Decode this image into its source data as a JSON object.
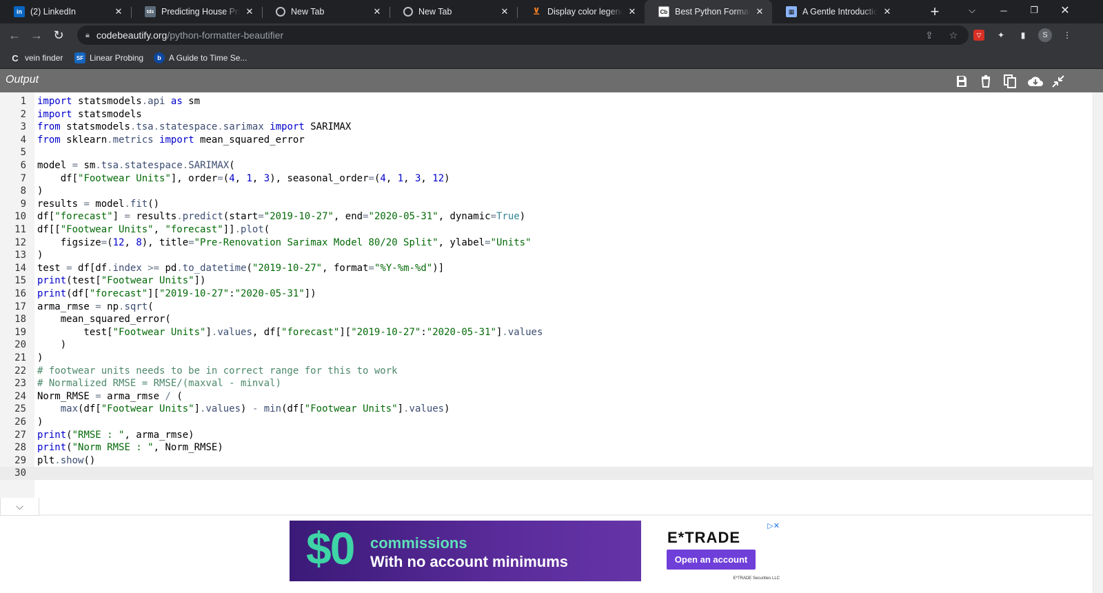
{
  "browser": {
    "tabs": [
      {
        "title": "(2) LinkedIn",
        "favicon": "linkedin-icon",
        "active": false
      },
      {
        "title": "Predicting House Prices",
        "favicon": "tds-icon",
        "active": false
      },
      {
        "title": "New Tab",
        "favicon": "globe-icon",
        "active": false
      },
      {
        "title": "New Tab",
        "favicon": "globe-icon",
        "active": false
      },
      {
        "title": "Display color legend on",
        "favicon": "stackoverflow-icon",
        "active": false
      },
      {
        "title": "Best Python Formatter a",
        "favicon": "codebeautify-icon",
        "active": true
      },
      {
        "title": "A Gentle Introduction t",
        "favicon": "article-icon",
        "active": false
      }
    ],
    "url_domain": "codebeautify.org",
    "url_path": "/python-formatter-beautifier",
    "profile_initial": "S",
    "bookmarks": [
      {
        "label": "vein finder",
        "icon": "c-icon"
      },
      {
        "label": "Linear Probing",
        "icon": "sf-icon"
      },
      {
        "label": "A Guide to Time Se...",
        "icon": "b-icon"
      }
    ]
  },
  "output": {
    "title": "Output"
  },
  "editor": {
    "lines": [
      {
        "n": "1",
        "html": "<span class=\"kw\">import</span> statsmodels<span class=\"op\">.</span><span class=\"fn\">api</span> <span class=\"kw\">as</span> sm"
      },
      {
        "n": "2",
        "html": "<span class=\"kw\">import</span> statsmodels"
      },
      {
        "n": "3",
        "html": "<span class=\"kw\">from</span> statsmodels<span class=\"op\">.</span><span class=\"fn\">tsa</span><span class=\"op\">.</span><span class=\"fn\">statespace</span><span class=\"op\">.</span><span class=\"fn\">sarimax</span> <span class=\"kw\">import</span> SARIMAX"
      },
      {
        "n": "4",
        "html": "<span class=\"kw\">from</span> sklearn<span class=\"op\">.</span><span class=\"fn\">metrics</span> <span class=\"kw\">import</span> mean_squared_error"
      },
      {
        "n": "5",
        "html": ""
      },
      {
        "n": "6",
        "html": "model <span class=\"op\">=</span> sm<span class=\"op\">.</span><span class=\"fn\">tsa</span><span class=\"op\">.</span><span class=\"fn\">statespace</span><span class=\"op\">.</span><span class=\"fn\">SARIMAX</span>("
      },
      {
        "n": "7",
        "html": "    df[<span class=\"str\">\"Footwear Units\"</span>], order<span class=\"op\">=</span>(<span class=\"num\">4</span>, <span class=\"num\">1</span>, <span class=\"num\">3</span>), seasonal_order<span class=\"op\">=</span>(<span class=\"num\">4</span>, <span class=\"num\">1</span>, <span class=\"num\">3</span>, <span class=\"num\">12</span>)"
      },
      {
        "n": "8",
        "html": ")"
      },
      {
        "n": "9",
        "html": "results <span class=\"op\">=</span> model<span class=\"op\">.</span><span class=\"fn\">fit</span>()"
      },
      {
        "n": "10",
        "html": "df[<span class=\"str\">\"forecast\"</span>] <span class=\"op\">=</span> results<span class=\"op\">.</span><span class=\"fn\">predict</span>(start<span class=\"op\">=</span><span class=\"str\">\"2019-10-27\"</span>, end<span class=\"op\">=</span><span class=\"str\">\"2020-05-31\"</span>, dynamic<span class=\"op\">=</span><span class=\"var\">True</span>)"
      },
      {
        "n": "11",
        "html": "df[[<span class=\"str\">\"Footwear Units\"</span>, <span class=\"str\">\"forecast\"</span>]]<span class=\"op\">.</span><span class=\"fn\">plot</span>("
      },
      {
        "n": "12",
        "html": "    figsize<span class=\"op\">=</span>(<span class=\"num\">12</span>, <span class=\"num\">8</span>), title<span class=\"op\">=</span><span class=\"str\">\"Pre-Renovation Sarimax Model 80/20 Split\"</span>, ylabel<span class=\"op\">=</span><span class=\"str\">\"Units\"</span>"
      },
      {
        "n": "13",
        "html": ")"
      },
      {
        "n": "14",
        "html": "test <span class=\"op\">=</span> df[df<span class=\"op\">.</span><span class=\"fn\">index</span> <span class=\"op\">&gt;=</span> pd<span class=\"op\">.</span><span class=\"fn\">to_datetime</span>(<span class=\"str\">\"2019-10-27\"</span>, format<span class=\"op\">=</span><span class=\"str\">\"%Y-%m-%d\"</span>)]"
      },
      {
        "n": "15",
        "html": "<span class=\"kw\">print</span>(test[<span class=\"str\">\"Footwear Units\"</span>])"
      },
      {
        "n": "16",
        "html": "<span class=\"kw\">print</span>(df[<span class=\"str\">\"forecast\"</span>][<span class=\"str\">\"2019-10-27\"</span>:<span class=\"str\">\"2020-05-31\"</span>])"
      },
      {
        "n": "17",
        "html": "arma_rmse <span class=\"op\">=</span> np<span class=\"op\">.</span><span class=\"fn\">sqrt</span>("
      },
      {
        "n": "18",
        "html": "    mean_squared_error("
      },
      {
        "n": "19",
        "html": "        test[<span class=\"str\">\"Footwear Units\"</span>]<span class=\"op\">.</span><span class=\"fn\">values</span>, df[<span class=\"str\">\"forecast\"</span>][<span class=\"str\">\"2019-10-27\"</span>:<span class=\"str\">\"2020-05-31\"</span>]<span class=\"op\">.</span><span class=\"fn\">values</span>"
      },
      {
        "n": "20",
        "html": "    )"
      },
      {
        "n": "21",
        "html": ")"
      },
      {
        "n": "22",
        "html": "<span class=\"cm\"># footwear units needs to be in correct range for this to work</span>"
      },
      {
        "n": "23",
        "html": "<span class=\"cm\"># Normalized RMSE = RMSE/(maxval - minval)</span>"
      },
      {
        "n": "24",
        "html": "Norm_RMSE <span class=\"op\">=</span> arma_rmse <span class=\"op\">/</span> ("
      },
      {
        "n": "25",
        "html": "    <span class=\"fn\">max</span>(df[<span class=\"str\">\"Footwear Units\"</span>]<span class=\"op\">.</span><span class=\"fn\">values</span>) <span class=\"op\">-</span> <span class=\"fn\">min</span>(df[<span class=\"str\">\"Footwear Units\"</span>]<span class=\"op\">.</span><span class=\"fn\">values</span>)"
      },
      {
        "n": "26",
        "html": ")"
      },
      {
        "n": "27",
        "html": "<span class=\"kw\">print</span>(<span class=\"str\">\"RMSE : \"</span>, arma_rmse)"
      },
      {
        "n": "28",
        "html": "<span class=\"kw\">print</span>(<span class=\"str\">\"Norm RMSE : \"</span>, Norm_RMSE)"
      },
      {
        "n": "29",
        "html": "plt<span class=\"op\">.</span><span class=\"fn\">show</span>()"
      },
      {
        "n": "30",
        "html": ""
      }
    ],
    "current_line": "30"
  },
  "ad": {
    "big": "$0",
    "line1": "commissions",
    "line2": "With no account minimums",
    "brand": "E*TRADE",
    "cta": "Open an account",
    "legal": "E*TRADE Securities LLC"
  }
}
